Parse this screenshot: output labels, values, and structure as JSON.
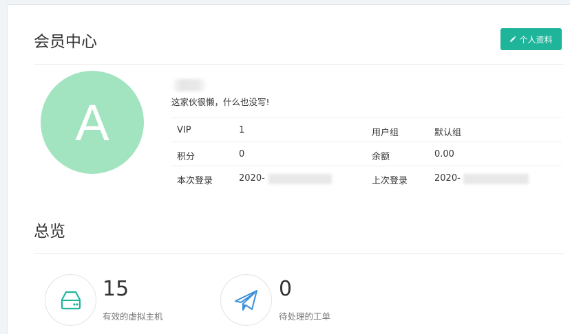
{
  "header": {
    "title": "会员中心",
    "profile_button": "个人资料",
    "accent": "#1fb59a"
  },
  "profile": {
    "avatar_letter": "A",
    "avatar_color": "#a3e4c0",
    "bio": "这家伙很懒，什么也没写!",
    "rows": [
      {
        "label1": "VIP",
        "value1": "1",
        "label2": "用户组",
        "value2": "默认组"
      },
      {
        "label1": "积分",
        "value1": "0",
        "label2": "余额",
        "value2": "0.00"
      },
      {
        "label1": "本次登录",
        "value1": "2020-",
        "label2": "上次登录",
        "value2": "2020-"
      }
    ]
  },
  "overview": {
    "title": "总览",
    "stats": [
      {
        "icon": "server-icon",
        "value": "15",
        "label": "有效的虚拟主机"
      },
      {
        "icon": "paper-plane-icon",
        "value": "0",
        "label": "待处理的工单"
      }
    ]
  }
}
